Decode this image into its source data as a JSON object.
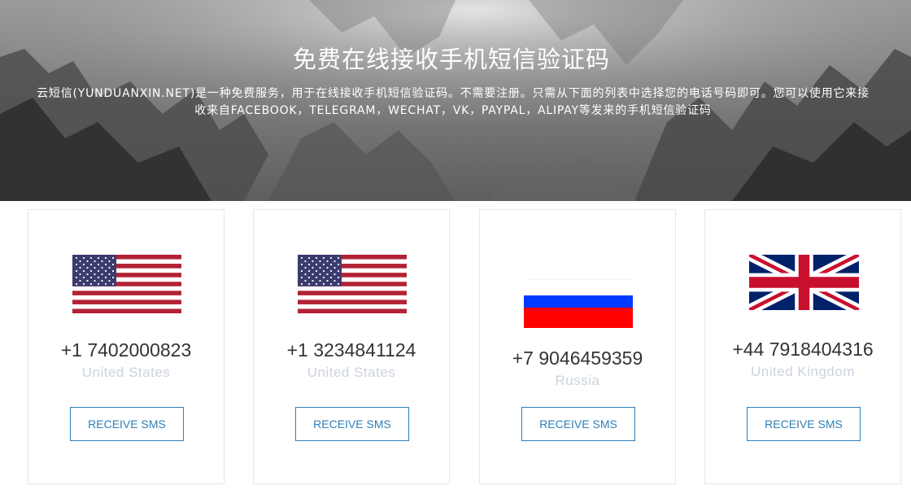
{
  "hero": {
    "title": "免费在线接收手机短信验证码",
    "description_line1": "云短信(YUNDUANXIN.NET)是一种免费服务，用于在线接收手机短信验证码。不需要注册。只需从下面的列表中选择您的电话号码即可。您可以使用它来接",
    "description_line2": "收来自FACEBOOK，TELEGRAM，WECHAT，VK，PAYPAL，ALIPAY等发来的手机短信验证码"
  },
  "numbers": [
    {
      "phone": "+1 7402000823",
      "country": "United States",
      "flag": "us-flag-icon",
      "button": "RECEIVE SMS"
    },
    {
      "phone": "+1 3234841124",
      "country": "United States",
      "flag": "us-flag-icon",
      "button": "RECEIVE SMS"
    },
    {
      "phone": "+7 9046459359",
      "country": "Russia",
      "flag": "russia-flag-icon",
      "button": "RECEIVE SMS"
    },
    {
      "phone": "+44 7918404316",
      "country": "United Kingdom",
      "flag": "uk-flag-icon",
      "button": "RECEIVE SMS"
    }
  ],
  "colors": {
    "button_accent": "#2e7fb8",
    "country_text": "#ccd3dc",
    "phone_text": "#333333"
  }
}
